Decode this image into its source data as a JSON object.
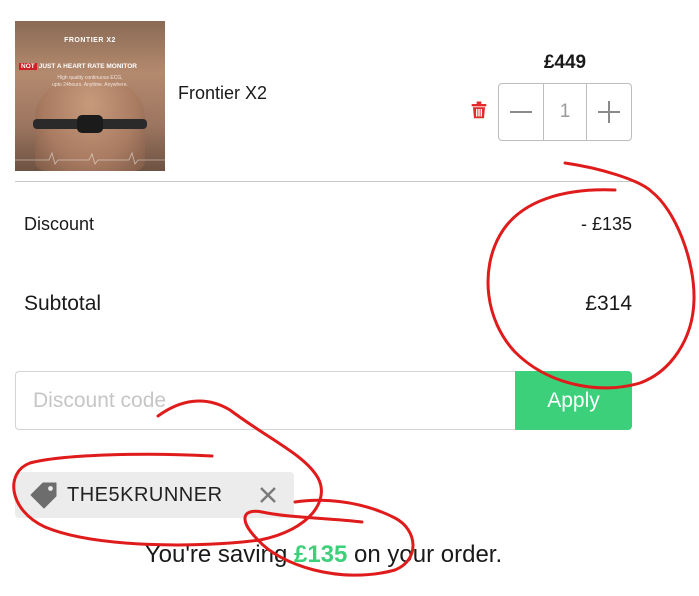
{
  "item": {
    "name": "Frontier X2",
    "price": "£449",
    "quantity": "1",
    "image": {
      "brand": "FRONTIER X2",
      "headline_badge": "NOT",
      "headline_rest": "JUST A HEART RATE MONITOR",
      "subline_1": "High quality continuous ECG,",
      "subline_2": "upto 24hours. Anytime. Anywhere."
    }
  },
  "summary": {
    "discount_label": "Discount",
    "discount_value": "- £135",
    "subtotal_label": "Subtotal",
    "subtotal_value": "£314"
  },
  "discount_form": {
    "placeholder": "Discount code",
    "apply_label": "Apply"
  },
  "applied_code": "THE5KRUNNER",
  "savings": {
    "prefix": "You're saving ",
    "amount": "£135",
    "suffix": " on your order."
  },
  "icons": {
    "remove_item": "trash-icon",
    "decrease": "minus-icon",
    "increase": "plus-icon",
    "coupon": "tag-icon",
    "remove_code": "close-icon"
  },
  "colors": {
    "accent_green": "#3dd07a",
    "trash_red": "#e02b2b",
    "annotation_red": "#e01b1b",
    "tag_background": "#ececec"
  }
}
